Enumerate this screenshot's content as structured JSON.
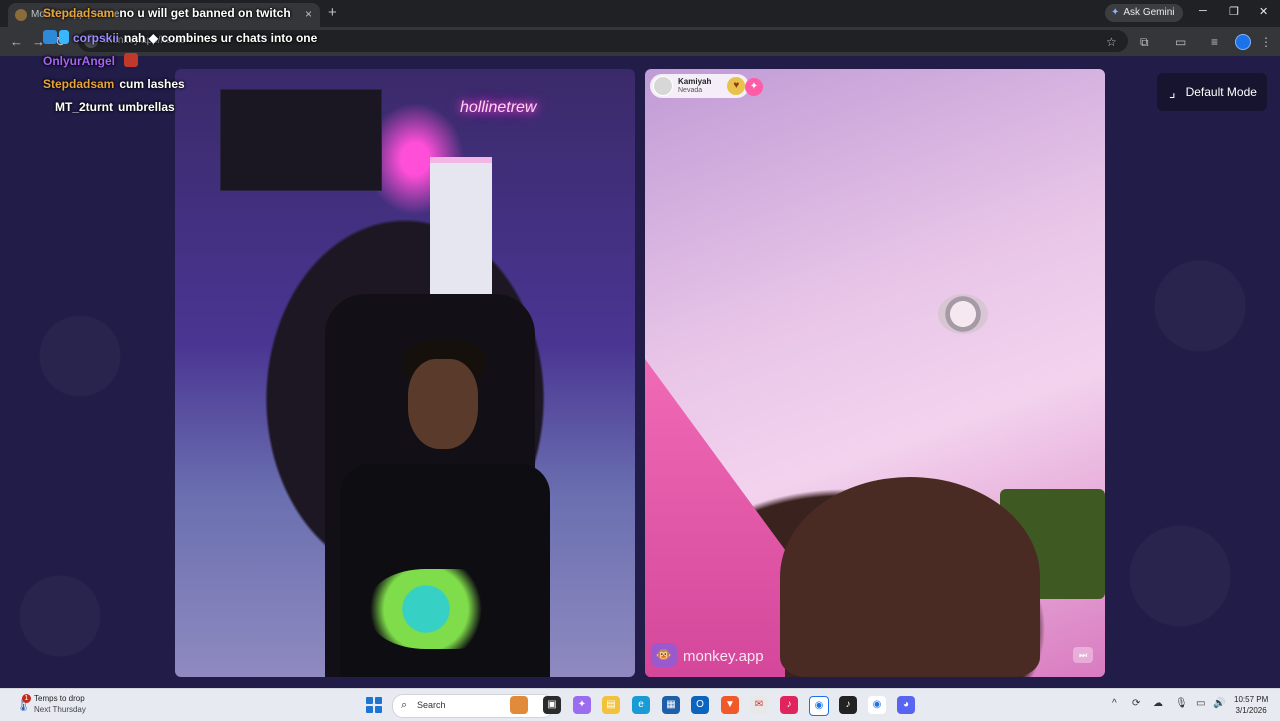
{
  "browser": {
    "tab_title": "Monkey.app | Home",
    "url": "monkey.app/home",
    "ask_gemini": "Ask Gemini",
    "close_tab": "×",
    "new_tab": "+",
    "minimize": "─",
    "restore": "❐",
    "close_window": "✕"
  },
  "chat": [
    {
      "user": "Stepdadsam",
      "color": "#e8a33a",
      "message": "no u will get banned on twitch"
    },
    {
      "user": "corpskii",
      "color": "#9b8cff",
      "message": "nah  ◆  combines ur chats into one"
    },
    {
      "user": "OnlyurAngel",
      "color": "#a563f0",
      "message": ""
    },
    {
      "user": "Stepdadsam",
      "color": "#e8a33a",
      "message": "cum lashes"
    },
    {
      "user": "MT_2turnt",
      "color": "#ffffff",
      "message": "umbrellas"
    }
  ],
  "mode_button": {
    "label": "Default Mode"
  },
  "neon_sign": "hollinetrew",
  "partner": {
    "name": "Kamiyah",
    "location": "Nevada"
  },
  "watermark": "monkey.app",
  "taskbar": {
    "weather_title": "Temps to drop",
    "weather_sub": "Next Thursday",
    "weather_badge": "1",
    "search_placeholder": "Search",
    "time": "10:57 PM",
    "date": "3/1/2026"
  }
}
